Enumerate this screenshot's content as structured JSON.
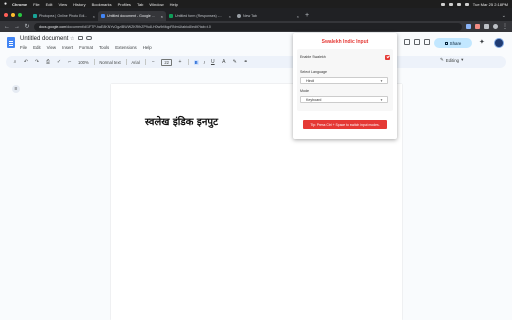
{
  "menubar": {
    "app": "Chrome",
    "items": [
      "File",
      "Edit",
      "View",
      "History",
      "Bookmarks",
      "Profiles",
      "Tab",
      "Window",
      "Help"
    ],
    "clock": "Tue Mar 25  2:18PM"
  },
  "tabs": [
    {
      "title": "Photopea | Online Photo Edi...",
      "favicon_color": "#18a497",
      "active": false
    },
    {
      "title": "Untitled document - Google ...",
      "favicon_color": "#4285f4",
      "active": true
    },
    {
      "title": "Untitled form (Responses) -...",
      "favicon_color": "#0f9d58",
      "active": false
    },
    {
      "title": "New Tab",
      "favicon_color": "#9aa0a6",
      "active": false
    }
  ],
  "address_bar": {
    "host": "docs.google.com",
    "path": "/document/d/1FTP-haE8KNYvOgzIBWWZKRfhZP9u8-H0w9rMqpRNmUtabio8/edit?tab=t.0"
  },
  "docs": {
    "title": "Untitled document",
    "menu": [
      "File",
      "Edit",
      "View",
      "Insert",
      "Format",
      "Tools",
      "Extensions",
      "Help"
    ],
    "share_label": "Share",
    "editing_label": "Editing"
  },
  "toolbar": {
    "zoom": "100%",
    "style": "Normal text",
    "font": "Arial",
    "font_size": "22",
    "bold": "B",
    "italic": "I"
  },
  "document": {
    "text": "स्वलेख इंडिक इनपुट"
  },
  "popup": {
    "title": "Swalekh Indic Input",
    "enable_label": "Enable Swalekh",
    "enabled": true,
    "language_label": "Select Language",
    "language_value": "Hindi",
    "mode_label": "Mode",
    "mode_value": "Keyboard",
    "tip": "Tip: Press Ctrl + Space to switch input modes.",
    "accent_color": "#e53935"
  }
}
